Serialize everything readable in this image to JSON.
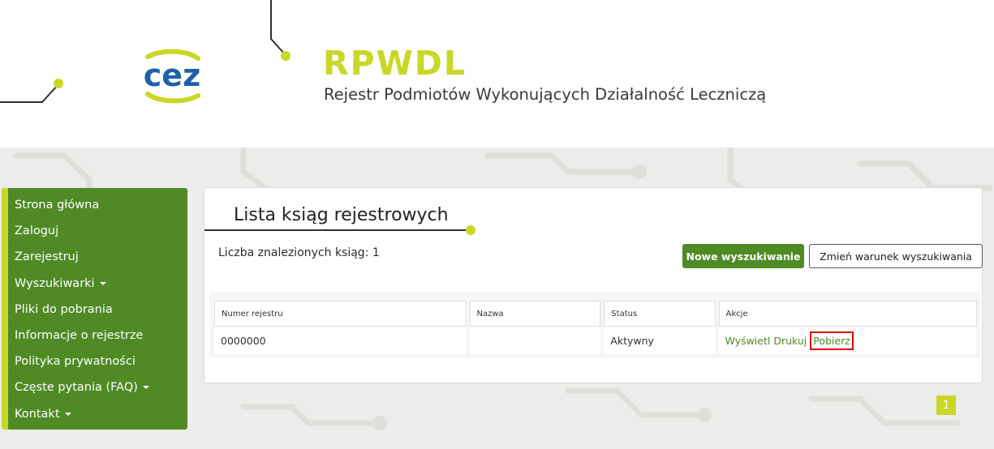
{
  "header": {
    "logo_text": "cez",
    "title": "RPWDL",
    "subtitle": "Rejestr Podmiotów Wykonujących Działalność Leczniczą"
  },
  "sidebar": {
    "items": [
      {
        "label": "Strona główna",
        "dropdown": false
      },
      {
        "label": "Zaloguj",
        "dropdown": false
      },
      {
        "label": "Zarejestruj",
        "dropdown": false
      },
      {
        "label": "Wyszukiwarki",
        "dropdown": true
      },
      {
        "label": "Pliki do pobrania",
        "dropdown": false
      },
      {
        "label": "Informacje o rejestrze",
        "dropdown": false
      },
      {
        "label": "Polityka prywatności",
        "dropdown": false
      },
      {
        "label": "Częste pytania (FAQ)",
        "dropdown": true
      },
      {
        "label": "Kontakt",
        "dropdown": true
      }
    ]
  },
  "main": {
    "title": "Lista ksiąg rejestrowych",
    "count_text": "Liczba znalezionych ksiąg: 1",
    "new_search_label": "Nowe wyszukiwanie",
    "change_condition_label": "Zmień warunek wyszukiwania",
    "table": {
      "columns": [
        "Numer rejestru",
        "Nazwa",
        "Status",
        "Akcje"
      ],
      "rows": [
        {
          "numer": "0000000",
          "nazwa": "",
          "status": "Aktywny",
          "actions": [
            "Wyświetl",
            "Drukuj",
            "Pobierz"
          ]
        }
      ]
    }
  },
  "pagination": {
    "current": "1"
  },
  "colors": {
    "brand_green": "#4f8a25",
    "accent_lime": "#c9d726",
    "highlight_red": "#e00000"
  }
}
